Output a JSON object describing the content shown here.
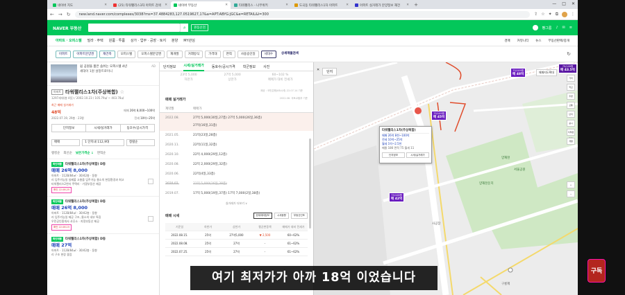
{
  "browser": {
    "tabs": [
      {
        "label": "네이버 지도",
        "active": false
      },
      {
        "label": "(25) 타워팰리스3차 아파트 검색",
        "active": false
      },
      {
        "label": "네이버 부동산",
        "active": true
      },
      {
        "label": "타워팰리스 - 나무위키",
        "active": false
      },
      {
        "label": "도곡동 타워팰리스1차 아파트",
        "active": false
      },
      {
        "label": "아파트 실거래가 분양정보 재건",
        "active": false
      }
    ],
    "url": "new.land.naver.com/complexes/3038?ms=37.4884283,127.0519627,17&a=APT:ABYG:JGC&e=RETAIL&l=300",
    "new_tab": "+",
    "win_controls": [
      "—",
      "□",
      "✕"
    ]
  },
  "header": {
    "brand": "NAVER 부동산",
    "search_button": "⌕",
    "complex_btn": "원동산검",
    "user": "빵그름",
    "icons": [
      "bell-icon",
      "chat-icon",
      "menu-icon"
    ]
  },
  "menu": {
    "items": [
      "아파트 · 오피스텔",
      "빌라 · 주택",
      "원룸 · 투룸",
      "상가 · 업무 · 공장 · 토지",
      "분양",
      "MY관심"
    ],
    "right": [
      "경매",
      "커뮤니티",
      "뉴스",
      "부동산판매/중개"
    ]
  },
  "filters": [
    "아파트",
    "아파트분양권",
    "재건축",
    "오피스텔",
    "오피스텔분양권",
    "재개발",
    "거래방식",
    "가격대",
    "면적",
    "사용승인일",
    "세대수",
    "상세매물검색"
  ],
  "left": {
    "ad_tag": "AD",
    "ad_line1": "쉼 공원을 품은 숨쉬는 오피스텔 4년",
    "ad_line2": "세대이 1원 설정트로이니",
    "complex_badge": "아파트",
    "complex_name": "타워팰리스1차(주상복합)",
    "complex_meta": "1297세대(총 4동) / 2002.10.23 / 105.79㎡ ~ 403.78㎡",
    "price_label": "최근 매매 실거래가",
    "price_value": "48억",
    "price_date": "2022.07.19, 29층 · 23평",
    "sale_label": "매매",
    "sale_value": "26억 8,000~100억",
    "jeonse_label": "전세",
    "jeonse_value": "10억~25억",
    "buttons": [
      "단지정보",
      "시세/실거래가",
      "동호수/공시가격"
    ],
    "sort": [
      "매매",
      "1 단지내 112,9대",
      "정렬순"
    ],
    "list_tabs": [
      "랭킹순",
      "최신순",
      "낮은가격순 ↓",
      "면적순"
    ],
    "listings": [
      {
        "badge": "확인매물",
        "title": "타워팰리스1차(주상복합) D동",
        "price": "매매 26억 8,000",
        "sub1": "아파트 · 112B/84㎡ · 30/42층 · 동향",
        "sub2": "리 입주가능일 실제불 고층을 입주가능 물소의 현장환경과 최고",
        "sub3": "타워팰리스2연자 주택리 · 가겠부동산 제공",
        "tag": "확인 22.08.25"
      },
      {
        "badge": "확인매물",
        "title": "타워팰리스1차(주상복합) D동",
        "price": "매매 26억 8,000",
        "sub1": "아파트 · 112B/84㎡ · 30/42층 · 동향",
        "sub2": "리 입주가능일 제공 구조, 물소의 내부 특징",
        "sub3": "우민공인중개사 사무소 · 지정부동산 제공",
        "tag": "확인 22.08.15"
      },
      {
        "badge": "확인매물",
        "title": "타워팰리스1차(주상복합) D동",
        "price": "매매 27억",
        "sub1": "아파트 · 112B/84㎡ · 30/42층 · 동향",
        "sub2": "리 구조 현장 좋음",
        "sub3": "",
        "tag": ""
      }
    ]
  },
  "detail": {
    "tabs": [
      "단지정보",
      "시세/실거래가",
      "동호수/공시가격",
      "학군정보",
      "사진"
    ],
    "stats": [
      {
        "v": "23억 5,000",
        "l": "하한가"
      },
      {
        "v": "27억 5,000",
        "l": "상한가"
      },
      {
        "v": "60~102 %",
        "l": "매매가 대비 전세가"
      }
    ],
    "stat_note": "제공 : 국민은행(KB시세) 22.07.14 기준",
    "section_title": "매매 실거래가",
    "section_note": "2022.08. 국토교통부 기준",
    "table_head": [
      "계약월",
      "매매가"
    ],
    "rows": [
      {
        "m": "2022.08.",
        "v": "27억 5,000(30일,27층)    27억 5,000(26일,36층)\n27억(16일,31층)"
      },
      {
        "m": "2021.05.",
        "v": "21억(23일,28층)"
      },
      {
        "m": "2020.11.",
        "v": "22억(11일,32층)"
      },
      {
        "m": "2020.10.",
        "v": "22억 4,000(29일,12층)"
      },
      {
        "m": "2020.08.",
        "v": "22억 2,000(29일,32층)"
      },
      {
        "m": "2020.06.",
        "v": "22억(4일,33층)"
      },
      {
        "m": "2020.02.",
        "v": "21억 5,000(16일,38층)"
      },
      {
        "m": "2019.07.",
        "v": "17억 5,000(19일,37층)     17억 7,000(2일,38층)"
      }
    ],
    "more": "실거래가 더보기 ∨",
    "sec2_title": "매매 시세",
    "sec2_btns": [
      "현재매매정보",
      "시세동향",
      "부동산인포"
    ],
    "grid_head": [
      "기준일",
      "하한가",
      "상한가",
      "평균변동액",
      "매매가 대비 전세가"
    ],
    "grid_rows": [
      {
        "d": "2022.08.15.",
        "lo": "25억",
        "hi": "27억5,000",
        "ch": "▼ 2,500",
        "r": "60~62%"
      },
      {
        "d": "2022.08.08.",
        "lo": "25억",
        "hi": "27억",
        "ch": "-",
        "r": "61~62%"
      },
      {
        "d": "2022.07.25.",
        "lo": "25억",
        "hi": "27억",
        "ch": "-",
        "r": "61~62%"
      }
    ]
  },
  "map": {
    "toggle": [
      "지도",
      "단지"
    ],
    "map_btn": "매매지도확대",
    "rail": [
      "menu-icon",
      "거리",
      "학교",
      "주변",
      "교통",
      "단지",
      "공시",
      "지적편집도",
      "개발"
    ],
    "popup": {
      "title": "타워팰리스1차(주상복합)",
      "line1": "매매 26억 8천~100억",
      "line2": "전세 10억~25억",
      "line3": "월세 1억~2.5천",
      "line4": "매물 186    면적 75    월세 11",
      "b1": "단지정보",
      "b2": "시세/실거래가"
    },
    "pins": [
      {
        "area": "75/109평",
        "v": "매 48억",
        "sub": "112B"
      },
      {
        "area": "75/109평",
        "v": "매 43.5억",
        "sub": "1/169"
      },
      {
        "area": "75/109평",
        "v": "매 45억",
        "sub": ""
      },
      {
        "area": "75/108평",
        "v": "매 42억",
        "sub": "3/2"
      }
    ],
    "labels": [
      "양재천",
      "양재천둔치",
      "구룡제",
      "서울공원",
      "사공장"
    ]
  },
  "overlay": {
    "subtitle": "여기 최저가가 아까 18억 이었습니다",
    "channel_btn": "구독"
  }
}
